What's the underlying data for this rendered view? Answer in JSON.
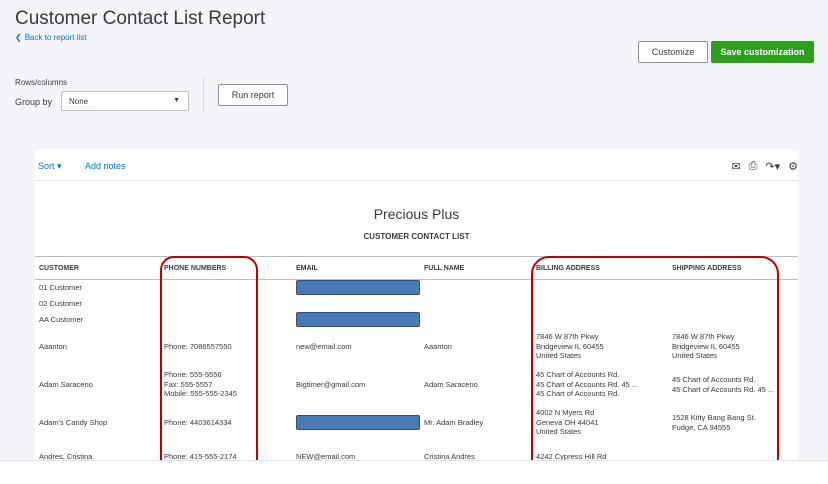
{
  "page": {
    "title": "Customer Contact List Report",
    "back_link": "Back to report list",
    "customize_label": "Customize",
    "save_label": "Save customization",
    "rows_columns_label": "Rows/columns",
    "group_by_label": "Group by",
    "group_by_value": "None",
    "run_report_label": "Run report"
  },
  "toolbar": {
    "sort_label": "Sort",
    "add_notes_label": "Add notes",
    "icons": [
      "email-icon",
      "print-icon",
      "export-icon",
      "settings-icon"
    ]
  },
  "report": {
    "company": "Precious Plus",
    "title": "CUSTOMER CONTACT LIST",
    "columns": [
      "CUSTOMER",
      "PHONE NUMBERS",
      "EMAIL",
      "FULL NAME",
      "BILLING ADDRESS",
      "SHIPPING ADDRESS"
    ],
    "rows": [
      {
        "customer": "01 Customer",
        "phone": [],
        "email": "",
        "email_redacted": true,
        "full_name": "",
        "billing": [],
        "shipping": []
      },
      {
        "customer": "02 Customer",
        "phone": [],
        "email": "",
        "email_redacted": false,
        "full_name": "",
        "billing": [],
        "shipping": []
      },
      {
        "customer": "AA Customer",
        "phone": [],
        "email": "",
        "email_redacted": true,
        "full_name": "",
        "billing": [],
        "shipping": []
      },
      {
        "customer": "Aaanton",
        "phone": [
          "Phone: 7086557550"
        ],
        "email": "new@email.com",
        "email_redacted": false,
        "full_name": "Aaanton",
        "billing": [
          "7846 W 87th Pkwy",
          "Bridgeview IL 60455",
          "United States"
        ],
        "shipping": [
          "7846 W 87th Pkwy",
          "Bridgeview IL 60455",
          "United States"
        ]
      },
      {
        "customer": "Adam Saraceno",
        "phone": [
          "Phone: 555-5556",
          "Fax: 555-5557",
          "Mobile: 555-555-2345"
        ],
        "email": "Bigtimer@gmail.com",
        "email_redacted": false,
        "full_name": "Adam Saraceno",
        "billing": [
          "45 Chart of Accounts Rd.",
          "45 Chart of Accounts Rd. 45 ...",
          "45 Chart of Accounts Rd."
        ],
        "shipping": [
          "45 Chart of Accounts Rd.",
          "45 Chart of Accounts Rd. 45 ..."
        ]
      },
      {
        "customer": "Adam's Candy Shop",
        "phone": [
          "Phone: 4403614334"
        ],
        "email": "",
        "email_redacted": true,
        "full_name": "Mr. Adam Bradley",
        "billing": [
          "4002 N Myers Rd",
          "Geneva OH 44041",
          "United States"
        ],
        "shipping": [
          "1528 Kitty Bang Bang St.",
          "Fudge, CA 94555"
        ]
      },
      {
        "customer": "Andres, Cristina",
        "phone": [
          "Phone: 415-555-2174"
        ],
        "email": "NEW@email.com",
        "email_redacted": false,
        "full_name": "Cristina Andres",
        "billing": [
          "4242 Cypress Hill Rd"
        ],
        "shipping": []
      }
    ]
  },
  "colors": {
    "accent": "#0077c5",
    "save_button": "#2ca01c",
    "annotation": "#c00000",
    "redaction": "#4a7ab5"
  }
}
